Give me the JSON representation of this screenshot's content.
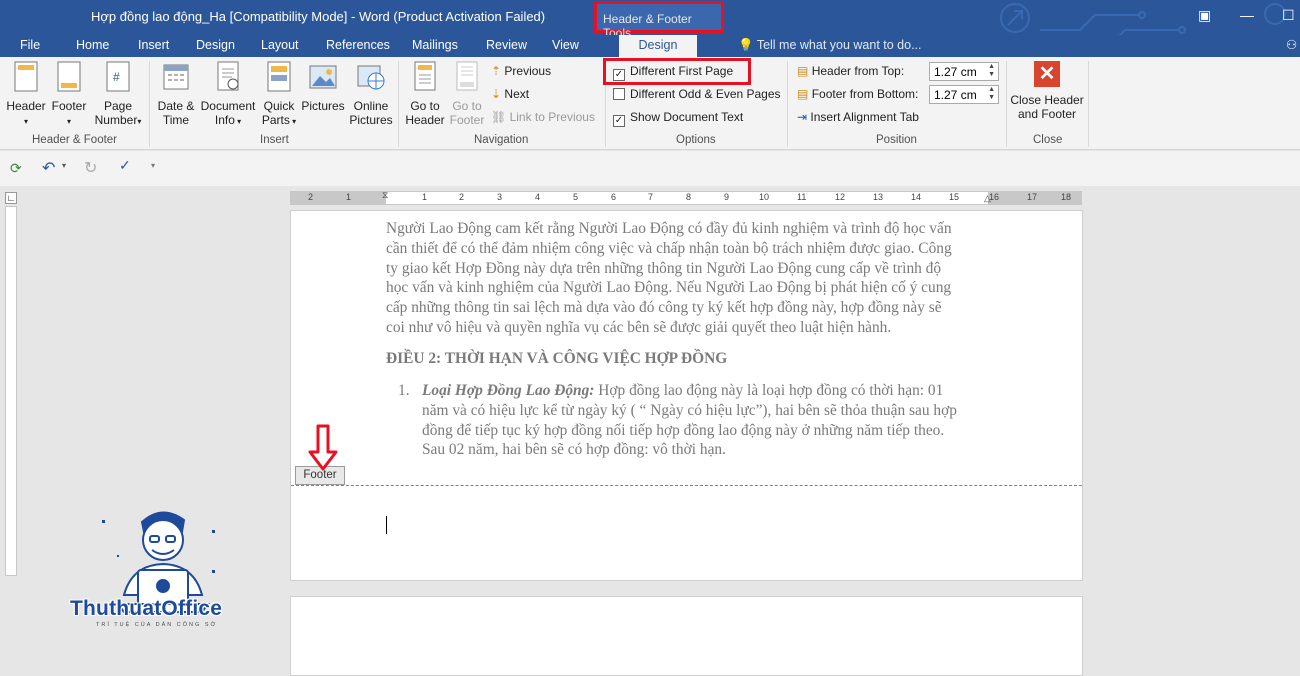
{
  "window": {
    "title": "Hợp đồng lao động_Ha [Compatibility Mode] - Word (Product Activation Failed)",
    "context_tab": "Header & Footer Tools"
  },
  "menu": {
    "tabs": [
      "File",
      "Home",
      "Insert",
      "Design",
      "Layout",
      "References",
      "Mailings",
      "Review",
      "View"
    ],
    "active_tab": "Design",
    "tell_me": "Tell me what you want to do..."
  },
  "ribbon": {
    "header_footer": {
      "header": "Header",
      "footer": "Footer",
      "page_number_1": "Page",
      "page_number_2": "Number",
      "label": "Header & Footer"
    },
    "insert": {
      "date_time_1": "Date &",
      "date_time_2": "Time",
      "doc_info_1": "Document",
      "doc_info_2": "Info",
      "quick_parts_1": "Quick",
      "quick_parts_2": "Parts",
      "pictures": "Pictures",
      "online_pictures_1": "Online",
      "online_pictures_2": "Pictures",
      "label": "Insert"
    },
    "navigation": {
      "goto_header_1": "Go to",
      "goto_header_2": "Header",
      "goto_footer_1": "Go to",
      "goto_footer_2": "Footer",
      "previous": "Previous",
      "next": "Next",
      "link_previous": "Link to Previous",
      "label": "Navigation"
    },
    "options": {
      "different_first_page": "Different First Page",
      "different_odd_even": "Different Odd & Even Pages",
      "show_document_text": "Show Document Text",
      "label": "Options"
    },
    "position": {
      "header_from_top": "Header from Top:",
      "header_from_top_value": "1.27 cm",
      "footer_from_bottom": "Footer from Bottom:",
      "footer_from_bottom_value": "1.27 cm",
      "insert_alignment_tab": "Insert Alignment Tab",
      "label": "Position"
    },
    "close": {
      "close_1": "Close Header",
      "close_2": "and Footer",
      "label": "Close"
    }
  },
  "ruler": {
    "ticks": [
      "2",
      "1",
      "1",
      "2",
      "3",
      "4",
      "5",
      "6",
      "7",
      "8",
      "9",
      "10",
      "11",
      "12",
      "13",
      "14",
      "15",
      "16",
      "17",
      "18"
    ]
  },
  "document": {
    "paragraph_lines": [
      "Người Lao Động cam kết rằng Người Lao Động có đầy đủ kinh nghiệm và trình độ học vấn",
      "cần thiết để có thể đảm nhiệm công việc và chấp nhận toàn bộ trách nhiệm được giao. Công",
      "ty giao kết Hợp Đồng này dựa trên những thông tin Người Lao Động cung cấp về trình độ",
      "học vấn và kinh nghiệm của Người Lao Động. Nếu Người Lao Động bị phát hiện cố ý cung",
      "cấp những thông tin sai lệch mà dựa vào đó công ty ký kết hợp đồng này, hợp đồng này sẽ",
      "coi như vô hiệu và quyền nghĩa vụ các bên sẽ được giải quyết theo luật hiện hành."
    ],
    "heading": "ĐIỀU 2: THỜI HẠN VÀ CÔNG VIỆC HỢP ĐỒNG",
    "item_number": "1.",
    "item_title": "Loại Hợp Đồng Lao Động:",
    "item_lines": [
      " Hợp đồng lao động này là loại hợp đồng có thời hạn: 01",
      "năm và có hiệu lực kể từ ngày ký ( “ Ngày có hiệu lực”), hai bên sẽ thỏa thuận sau hợp",
      "đồng để tiếp tục ký hợp đồng nối tiếp hợp đồng lao động này ở những năm tiếp theo.",
      "Sau 02 năm, hai bên sẽ có hợp đồng: vô thời hạn."
    ],
    "footer_tag": "Footer"
  },
  "watermark": {
    "brand": "ThuthuatOffice",
    "tagline": "TRÍ TUỆ CỦA DÂN CÔNG SỞ"
  }
}
